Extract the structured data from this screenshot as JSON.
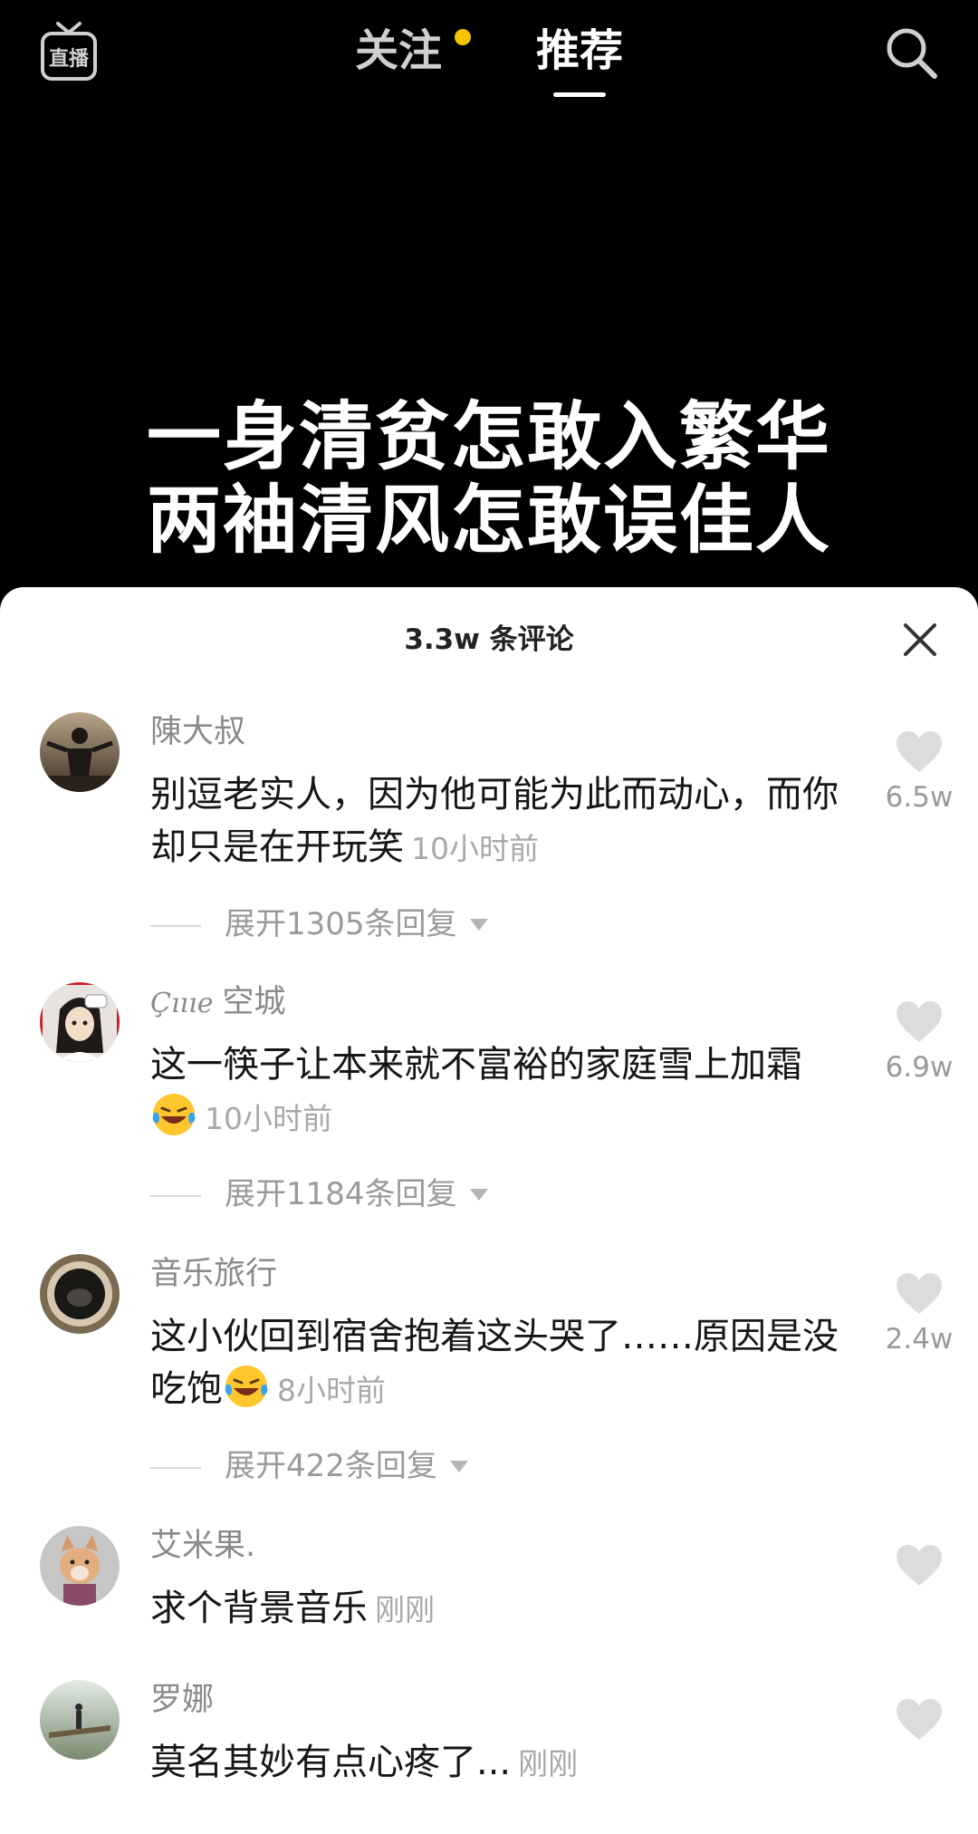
{
  "topbar": {
    "live_label": "直播",
    "tab_follow": "关注",
    "tab_recommend": "推荐"
  },
  "video": {
    "caption_line1": "一身清贫怎敢入繁华",
    "caption_line2": "两袖清风怎敢误佳人"
  },
  "comments_panel": {
    "title": "3.3w 条评论",
    "items": [
      {
        "username": "陳大叔",
        "text": "别逗老实人，因为他可能为此而动心，而你却只是在开玩笑",
        "time": "10小时前",
        "likes": "6.5w",
        "replies": "展开1305条回复"
      },
      {
        "username_prefix": "Çıııe",
        "username": "空城",
        "text": "这一筷子让本来就不富裕的家庭雪上加霜",
        "time": "10小时前",
        "likes": "6.9w",
        "replies": "展开1184条回复"
      },
      {
        "username": "音乐旅行",
        "text": "这小伙回到宿舍抱着这头哭了……原因是没吃饱",
        "time": "8小时前",
        "likes": "2.4w",
        "replies": "展开422条回复"
      },
      {
        "username": "艾米果.",
        "text": "求个背景音乐",
        "time": "刚刚",
        "likes": ""
      },
      {
        "username": "罗娜",
        "text": "莫名其妙有点心疼了...",
        "time": "刚刚",
        "likes": ""
      }
    ]
  },
  "colors": {
    "background": "#000000",
    "accent_dot": "#f5c400",
    "sheet": "#ffffff"
  }
}
